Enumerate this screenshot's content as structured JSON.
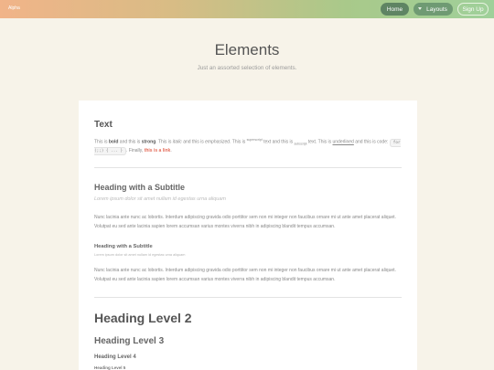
{
  "topbar": {
    "brand": "Alpha",
    "nav": {
      "home": "Home",
      "layouts": "Layouts",
      "signup": "Sign Up"
    }
  },
  "header": {
    "title": "Elements",
    "subtitle": "Just an assorted selection of elements."
  },
  "text_section": {
    "heading": "Text",
    "p_start": "This is ",
    "bold": "bold",
    "p_and": " and this is ",
    "strong": "strong",
    "p_mid1": ". This is ",
    "italic": "italic",
    "p_mid2": " and this is ",
    "emphasized": "emphasized",
    "p_mid3": ". This is ",
    "superscript": "superscript",
    "p_mid4": " text and this is ",
    "subscript": "subscript",
    "p_mid5": " text. This is ",
    "underlined": "underlined",
    "p_mid6": " and this is code: ",
    "code": "for (;;) { ... }",
    "p_mid7": ". Finally, ",
    "link": "this is a link",
    "p_end": "."
  },
  "subtitle_section": {
    "heading": "Heading with a Subtitle",
    "caption": "Lorem ipsum dolor sit amet nullam id egestas urna aliquam",
    "paragraph": "Nunc lacinia ante nunc ac lobortis. Interdum adipiscing gravida odio porttitor sem non mi integer non faucibus ornare mi ut ante amet placerat aliquet. Volutpat eu sed ante lacinia sapien lorem accumsan varius montes viverra nibh in adipiscing blandit tempus accumsan.",
    "small_heading": "Heading with a Subtitle",
    "small_caption": "Lorem ipsum dolor sit amet nullam id egestas urna aliquam",
    "paragraph2": "Nunc lacinia ante nunc ac lobortis. Interdum adipiscing gravida odio porttitor sem non mi integer non faucibus ornare mi ut ante amet placerat aliquet. Volutpat eu sed ante lacinia sapien lorem accumsan varius montes viverra nibh in adipiscing blandit tempus accumsan."
  },
  "headings": {
    "h2": "Heading Level 2",
    "h3": "Heading Level 3",
    "h4": "Heading Level 4",
    "h5": "Heading Level 5"
  }
}
